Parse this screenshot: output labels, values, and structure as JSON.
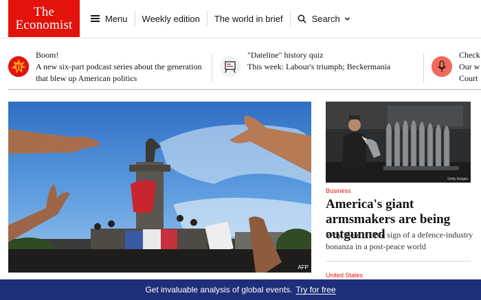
{
  "header": {
    "logo_line1": "The",
    "logo_line2": "Economist",
    "nav": {
      "menu_label": "Menu",
      "weekly_edition_label": "Weekly edition",
      "world_in_brief_label": "The world in brief",
      "search_label": "Search"
    }
  },
  "promos": [
    {
      "title": "Boom!",
      "text": "A new six-part podcast series about the generation that blew up American politics",
      "icon": "boom-podcast-icon",
      "icon_color": "#e3120b"
    },
    {
      "title": "\"Dateline\" history quiz",
      "text": "This week: Labour's triumph; Beckermania",
      "icon": "quiz-easel-icon"
    },
    {
      "title": "Check",
      "text_line2": "Our w",
      "text_line3": "Court",
      "icon": "microphone-icon",
      "icon_color": "#f06b5c"
    }
  ],
  "main_story": {
    "image": "crowd-at-monument-photo",
    "credit": "AFP"
  },
  "side_story": {
    "image": "artillery-shells-factory-photo",
    "image_credit": "Getty Images",
    "flytitle": "Business",
    "headline": "America's giant armsmakers are being outgunned",
    "rubric": "Why there is little sign of a defence-industry bonanza in a post-peace world"
  },
  "next_story": {
    "flytitle": "United States"
  },
  "banner": {
    "text": "Get invaluable analysis of global events.",
    "link_text": "Try for free"
  },
  "colors": {
    "brand_red": "#e3120b",
    "banner_navy": "#1f2e7a"
  }
}
